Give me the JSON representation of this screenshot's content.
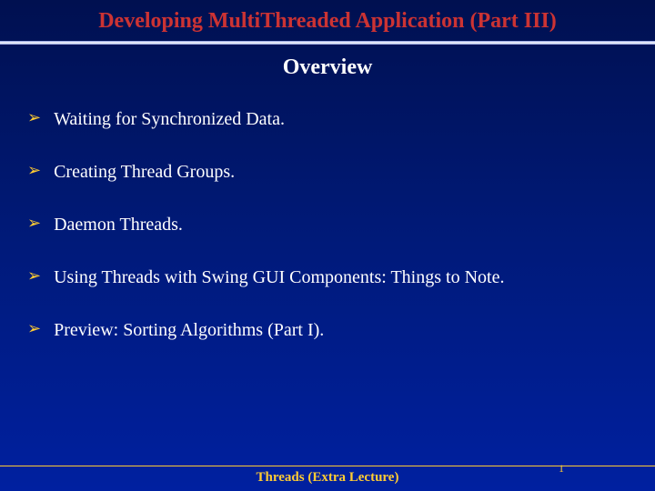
{
  "header": {
    "title": "Developing MultiThreaded Application (Part III)"
  },
  "subtitle": "Overview",
  "bullets": [
    "Waiting for Synchronized Data.",
    "Creating Thread Groups.",
    "Daemon Threads.",
    "Using Threads with Swing GUI Components: Things to Note.",
    "Preview: Sorting Algorithms (Part I)."
  ],
  "footer": {
    "text": "Threads (Extra Lecture)",
    "page": "1"
  }
}
